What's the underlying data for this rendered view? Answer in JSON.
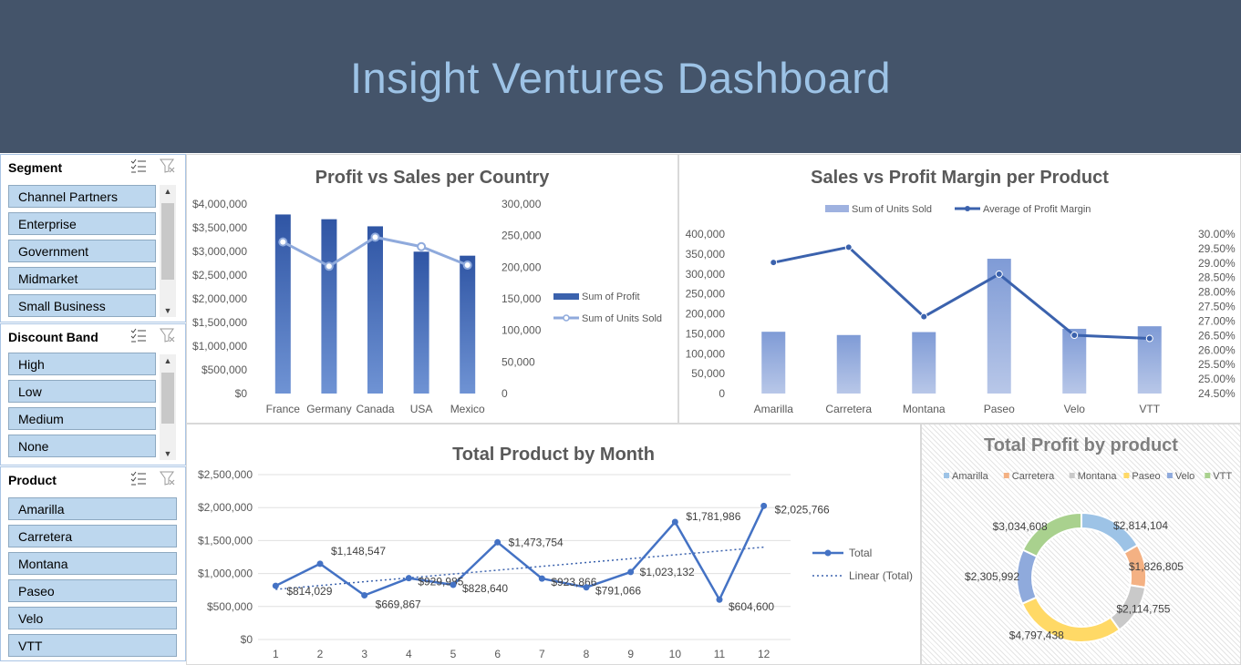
{
  "header": {
    "title": "Insight Ventures Dashboard"
  },
  "slicers": {
    "segment": {
      "title": "Segment",
      "items": [
        "Channel Partners",
        "Enterprise",
        "Government",
        "Midmarket",
        "Small Business"
      ]
    },
    "discount_band": {
      "title": "Discount Band",
      "items": [
        "High",
        "Low",
        "Medium",
        "None"
      ]
    },
    "product": {
      "title": "Product",
      "items": [
        "Amarilla",
        "Carretera",
        "Montana",
        "Paseo",
        "Velo",
        "VTT"
      ]
    }
  },
  "colors": {
    "header_bg": "#44546a",
    "title_text": "#9dc3e6",
    "slicer_item": "#bdd7ee",
    "bar": "#4472c4",
    "line_light": "#8faadc",
    "line_dark": "#3b62ad"
  },
  "chart_data": [
    {
      "id": "profit_vs_sales",
      "type": "bar",
      "title": "Profit vs Sales per Country",
      "categories": [
        "France",
        "Germany",
        "Canada",
        "USA",
        "Mexico"
      ],
      "series": [
        {
          "name": "Sum of Profit",
          "type": "bar",
          "axis": "left",
          "values": [
            3780000,
            3680000,
            3530000,
            2995000,
            2910000
          ]
        },
        {
          "name": "Sum of Units Sold",
          "type": "line",
          "axis": "right",
          "values": [
            240000,
            201500,
            247500,
            232600,
            203300
          ]
        }
      ],
      "y_left": {
        "min": 0,
        "max": 4000000,
        "ticks": [
          "$0",
          "$500,000",
          "$1,000,000",
          "$1,500,000",
          "$2,000,000",
          "$2,500,000",
          "$3,000,000",
          "$3,500,000",
          "$4,000,000"
        ]
      },
      "y_right": {
        "min": 0,
        "max": 300000,
        "ticks": [
          "0",
          "50,000",
          "100,000",
          "150,000",
          "200,000",
          "250,000",
          "300,000"
        ]
      },
      "legend": "right"
    },
    {
      "id": "sales_vs_margin",
      "type": "bar",
      "title": "Sales vs Profit Margin per Product",
      "categories": [
        "Amarilla",
        "Carretera",
        "Montana",
        "Paseo",
        "Velo",
        "VTT"
      ],
      "series": [
        {
          "name": "Sum of Units Sold",
          "type": "bar",
          "axis": "left",
          "values": [
            155000,
            146800,
            154200,
            338200,
            162400,
            168800
          ]
        },
        {
          "name": "Average of Profit Margin",
          "type": "line",
          "axis": "right",
          "values": [
            0.2902,
            0.2955,
            0.2715,
            0.2862,
            0.2651,
            0.264
          ]
        }
      ],
      "y_left": {
        "min": 0,
        "max": 400000,
        "ticks": [
          "0",
          "50,000",
          "100,000",
          "150,000",
          "200,000",
          "250,000",
          "300,000",
          "350,000",
          "400,000"
        ]
      },
      "y_right": {
        "min": 0.245,
        "max": 0.3,
        "ticks": [
          "24.50%",
          "25.00%",
          "25.50%",
          "26.00%",
          "26.50%",
          "27.00%",
          "27.50%",
          "28.00%",
          "28.50%",
          "29.00%",
          "29.50%",
          "30.00%"
        ]
      },
      "legend": "top"
    },
    {
      "id": "product_by_month",
      "type": "line",
      "title": "Total Product by Month",
      "x": [
        1,
        2,
        3,
        4,
        5,
        6,
        7,
        8,
        9,
        10,
        11,
        12
      ],
      "series": [
        {
          "name": "Total",
          "values": [
            814029,
            1148547,
            669867,
            929985,
            828640,
            1473754,
            923866,
            791066,
            1023132,
            1781986,
            604600,
            2025766
          ],
          "labels": [
            "$814,029",
            "$1,148,547",
            "$669,867",
            "$929,985",
            "$828,640",
            "$1,473,754",
            "$923,866",
            "$791,066",
            "$1,023,132",
            "$1,781,986",
            "$604,600",
            "$2,025,766"
          ]
        }
      ],
      "trendline": {
        "name": "Linear (Total)",
        "start": 760000,
        "end": 1400000
      },
      "y": {
        "min": 0,
        "max": 2500000,
        "ticks": [
          "$0",
          "$500,000",
          "$1,000,000",
          "$1,500,000",
          "$2,000,000",
          "$2,500,000"
        ]
      },
      "legend": "right"
    },
    {
      "id": "profit_by_product",
      "type": "pie",
      "title": "Total Profit by product",
      "series": [
        {
          "name": "Amarilla",
          "value": 2814104,
          "label": "$2,814,104",
          "color": "#9dc3e6"
        },
        {
          "name": "Carretera",
          "value": 1826805,
          "label": "$1,826,805",
          "color": "#f4b183"
        },
        {
          "name": "Montana",
          "value": 2114755,
          "label": "$2,114,755",
          "color": "#c9c9c9"
        },
        {
          "name": "Paseo",
          "value": 4797438,
          "label": "$4,797,438",
          "color": "#ffd966"
        },
        {
          "name": "Velo",
          "value": 2305992,
          "label": "$2,305,992",
          "color": "#8faadc"
        },
        {
          "name": "VTT",
          "value": 3034608,
          "label": "$3,034,608",
          "color": "#a9d18e"
        }
      ],
      "legend": "top"
    }
  ]
}
